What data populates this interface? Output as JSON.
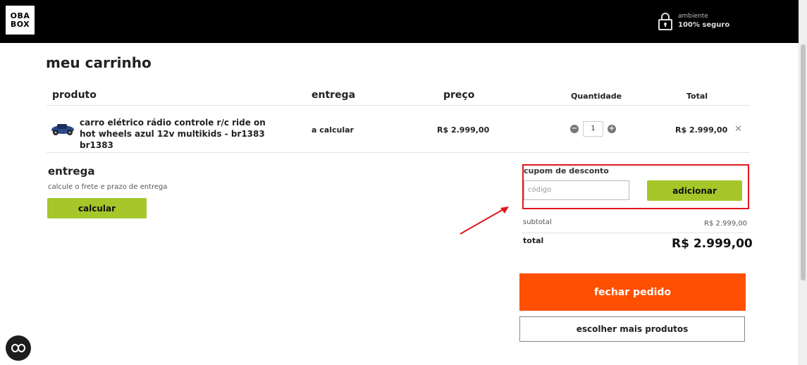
{
  "header": {
    "logo_line1": "OBA",
    "logo_line2": "BOX",
    "secure_line1": "ambiente",
    "secure_line2": "100% seguro"
  },
  "page_title": "meu carrinho",
  "table": {
    "columns": [
      "produto",
      "entrega",
      "preço",
      "Quantidade",
      "Total"
    ],
    "rows": [
      {
        "product": "carro elétrico rádio controle r/c ride on hot wheels azul 12v multikids - br1383 br1383",
        "delivery": "a calcular",
        "price": "R$ 2.999,00",
        "quantity": "1",
        "total": "R$ 2.999,00",
        "remove_glyph": "✕"
      }
    ]
  },
  "delivery": {
    "title": "entrega",
    "subtitle": "calcule o frete e prazo de entrega",
    "button": "calcular"
  },
  "coupon": {
    "title": "cupom de desconto",
    "placeholder": "código",
    "button": "adicionar"
  },
  "summary": {
    "subtotal_label": "subtotal",
    "subtotal_value": "R$ 2.999,00",
    "total_label": "total",
    "total_value": "R$ 2.999,00"
  },
  "actions": {
    "checkout": "fechar pedido",
    "continue": "escolher mais produtos"
  },
  "colors": {
    "accent_green": "#a6c72a",
    "checkout_orange": "#ff4f00",
    "highlight_red": "#e0181c"
  }
}
